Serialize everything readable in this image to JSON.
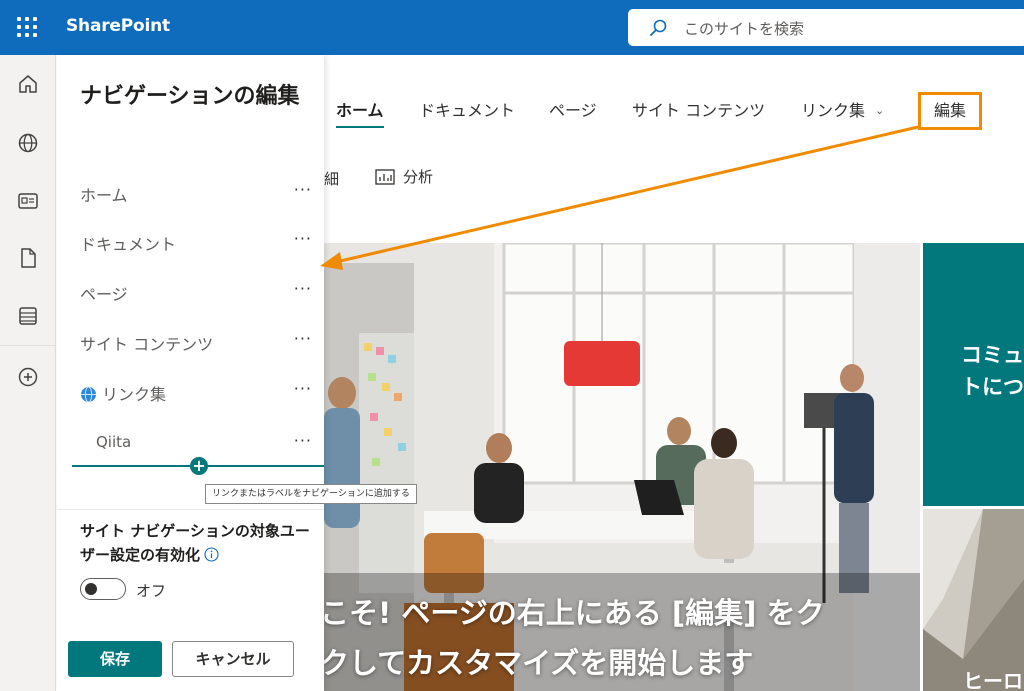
{
  "suite": {
    "brand": "SharePoint",
    "search_placeholder": "このサイトを検索"
  },
  "appbar": {
    "icons": [
      "home-icon",
      "globe-icon",
      "news-icon",
      "document-icon",
      "list-icon",
      "add-circle-icon"
    ]
  },
  "panel": {
    "title": "ナビゲーションの編集",
    "items": [
      {
        "label": "ホーム",
        "more": "···"
      },
      {
        "label": "ドキュメント",
        "more": "···"
      },
      {
        "label": "ページ",
        "more": "···"
      },
      {
        "label": "サイト コンテンツ",
        "more": "···"
      },
      {
        "label": "リンク集",
        "more": "···",
        "icon": "globe-icon"
      },
      {
        "label": "Qiita",
        "more": "···"
      }
    ],
    "add_tooltip": "リンクまたはラベルをナビゲーションに追加する",
    "audience_title": "サイト ナビゲーションの対象ユーザー設定の有効化",
    "toggle_label": "オフ",
    "save_label": "保存",
    "cancel_label": "キャンセル"
  },
  "sitenav": {
    "items": [
      "ホーム",
      "ドキュメント",
      "ページ",
      "サイト コンテンツ",
      "リンク集"
    ],
    "active": "ホーム",
    "edit_label": "編集"
  },
  "commandbar": {
    "partial_label": "細",
    "analytics_label": "分析"
  },
  "hero": {
    "line1": "こそ! ページの右上にある [編集] をク",
    "line2": "クしてカスタマイズを開始します",
    "tile1_line1": "コミュ",
    "tile1_line2": "トにつ",
    "tile2_text": "ヒーロ"
  },
  "colors": {
    "suite_blue": "#0f6cbd",
    "theme_teal": "#03787c",
    "highlight_orange": "#f08a00"
  }
}
